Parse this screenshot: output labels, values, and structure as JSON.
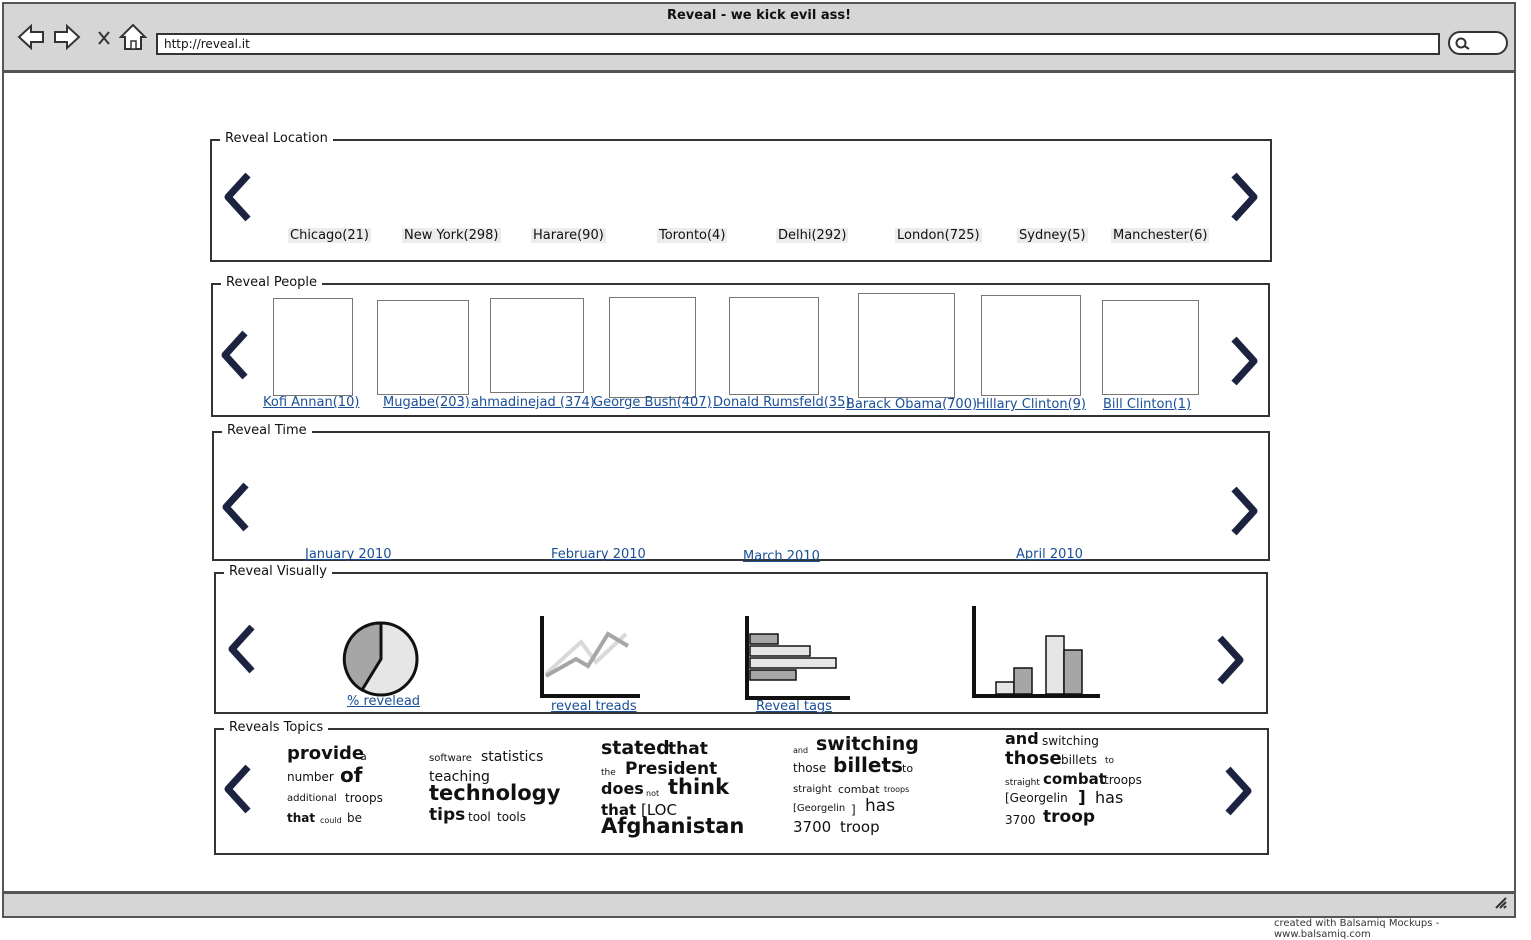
{
  "window": {
    "title": "Reveal - we kick evil ass!",
    "url": "http://reveal.it"
  },
  "footer_credit": "created with Balsamiq Mockups - www.balsamiq.com",
  "sections": {
    "location": {
      "title": "Reveal Location",
      "items": [
        "Chicago(21)",
        "New York(298)",
        "Harare(90)",
        "Toronto(4)",
        "Delhi(292)",
        "London(725)",
        "Sydney(5)",
        "Manchester(6)"
      ]
    },
    "people": {
      "title": "Reveal People",
      "items": [
        "Kofi Annan(10)",
        "Mugabe(203)",
        "ahmadinejad (374)",
        "George Bush(407)",
        "Donald Rumsfeld(35)",
        "Barack Obama(700)",
        "Hillary Clinton(9)",
        "Bill Clinton(1)"
      ]
    },
    "time": {
      "title": "Reveal Time",
      "items": [
        "January 2010",
        "February 2010",
        "March 2010",
        "April 2010"
      ]
    },
    "visually": {
      "title": "Reveal Visually",
      "items": [
        "% revelead",
        "reveal treads",
        "Reveal tags"
      ]
    },
    "topics": {
      "title": "Reveals Topics",
      "clouds": [
        [
          "provide",
          "a",
          "number",
          "of",
          "additional",
          "troops",
          "that",
          "could",
          "be"
        ],
        [
          "software",
          "statistics",
          "teaching",
          "technology",
          "tips",
          "tool",
          "tools"
        ],
        [
          "stated",
          "that",
          "the",
          "President",
          "does",
          "not",
          "think",
          "that",
          "[LOC",
          "Afghanistan"
        ],
        [
          "and",
          "switching",
          "those",
          "billets",
          "to",
          "straight",
          "combat",
          "troops",
          "[Georgelin",
          "]",
          "has",
          "3700",
          "troop"
        ],
        [
          "and",
          "switching",
          "those",
          "billets",
          "to",
          "straight",
          "combat",
          "troops",
          "[Georgelin",
          "]",
          "has",
          "3700",
          "troop"
        ]
      ]
    }
  },
  "colors": {
    "link": "#1a4f95",
    "chrome": "#d6d6d6",
    "border": "#333333",
    "bar_light": "#e6e6e6",
    "bar_dark": "#a6a6a6",
    "map_road": "#f5f0a0",
    "map_park": "#a8d08d",
    "pin": "#d9534f"
  },
  "icons": [
    "back-arrow-icon",
    "forward-arrow-icon",
    "close-x-icon",
    "home-icon",
    "search-icon",
    "chevron-left-icon",
    "chevron-right-icon",
    "map-pin-icon",
    "resize-grip-icon"
  ]
}
